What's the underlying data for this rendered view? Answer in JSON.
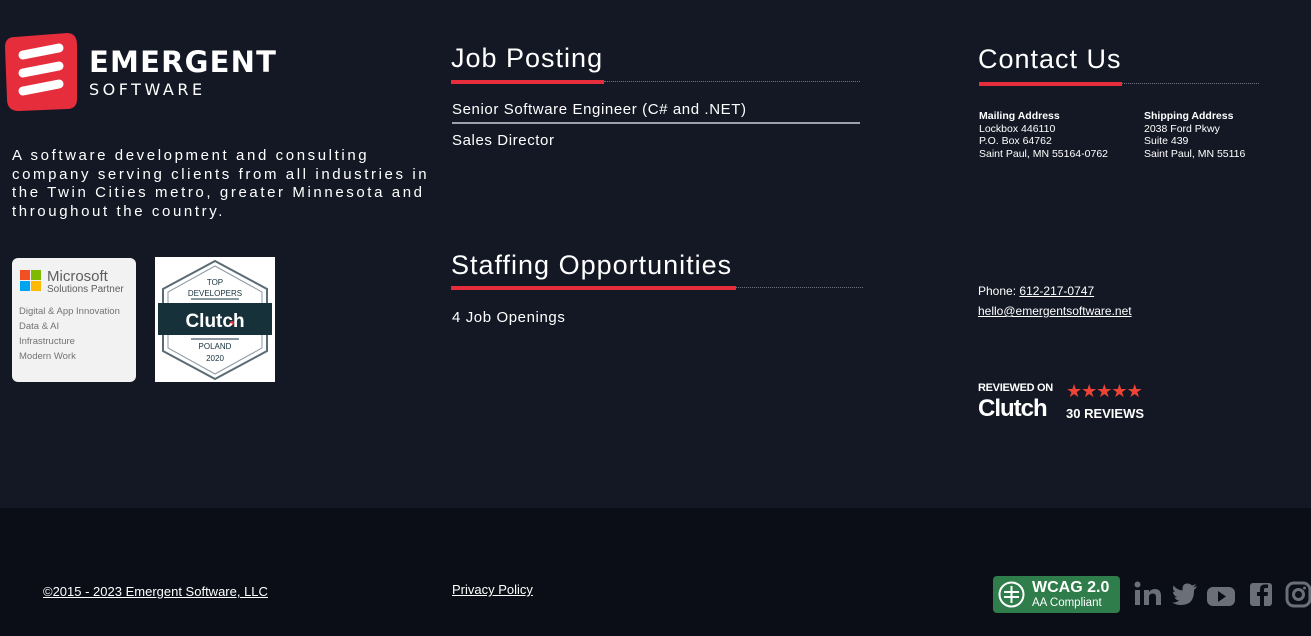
{
  "brand": {
    "name": "EMERGENT",
    "tagline": "SOFTWARE",
    "description": "A software development and consulting company serving clients from all industries in the Twin Cities metro, greater Minnesota and throughout the country.",
    "colors": {
      "accent_red": "#e52d3c",
      "background": "#141824",
      "footer_background": "#0b0e16",
      "wcag_green": "#2e7d4a"
    }
  },
  "badges": {
    "microsoft": {
      "name": "Microsoft",
      "partner": "Solutions Partner",
      "areas": [
        "Digital & App Innovation",
        "Data & AI",
        "Infrastructure",
        "Modern Work"
      ]
    },
    "clutch_badge": {
      "top": "TOP",
      "category": "DEVELOPERS",
      "brand": "Clutch",
      "region": "POLAND",
      "year": "2020"
    }
  },
  "job_posting": {
    "title": "Job Posting",
    "items": [
      "Senior Software Engineer (C# and .NET)",
      "Sales Director"
    ]
  },
  "staffing": {
    "title": "Staffing Opportunities",
    "items": [
      "4 Job Openings"
    ]
  },
  "contact": {
    "title": "Contact Us",
    "mailing": {
      "heading": "Mailing Address",
      "lines": [
        "Lockbox 446110",
        "P.O. Box 64762",
        "Saint Paul, MN 55164-0762"
      ]
    },
    "shipping": {
      "heading": "Shipping Address",
      "lines": [
        "2038 Ford Pkwy",
        "Suite 439",
        "Saint Paul, MN 55116"
      ]
    },
    "phone_label": "Phone:",
    "phone": "612-217-0747",
    "email": "hello@emergentsoftware.net"
  },
  "clutch_review": {
    "label": "REVIEWED ON",
    "brand": "Clutch",
    "stars": 5,
    "reviews": "30 REVIEWS"
  },
  "footer": {
    "copyright": "©2015 - 2023 Emergent Software, LLC",
    "privacy": "Privacy Policy",
    "wcag": {
      "title": "WCAG 2.0",
      "subtitle": "AA Compliant"
    },
    "social": [
      "linkedin-icon",
      "twitter-icon",
      "youtube-icon",
      "facebook-icon",
      "instagram-icon"
    ]
  }
}
